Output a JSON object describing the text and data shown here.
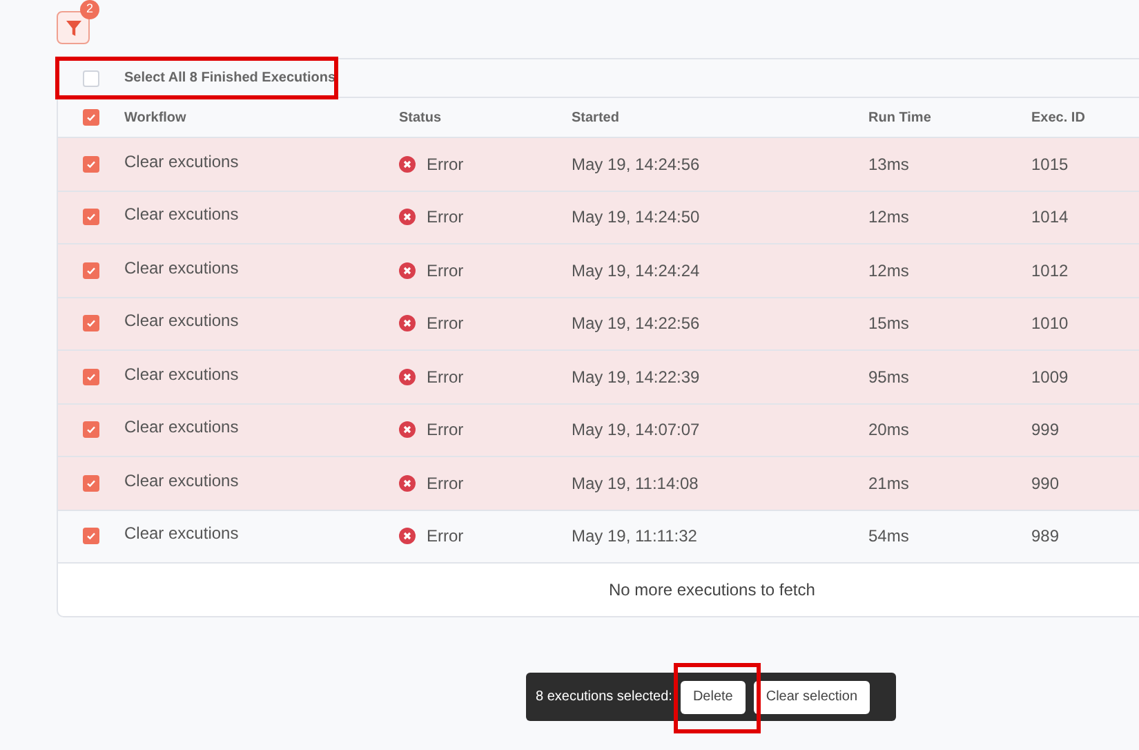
{
  "filter": {
    "badge": "2"
  },
  "select_all": {
    "label": "Select All 8 Finished Executions",
    "checked": false
  },
  "table": {
    "header_checked": true,
    "columns": [
      "Workflow",
      "Status",
      "Started",
      "Run Time",
      "Exec. ID"
    ],
    "rows": [
      {
        "workflow": "Clear excutions",
        "status": "Error",
        "started": "May 19, 14:24:56",
        "run_time": "13ms",
        "exec_id": "1015",
        "checked": true,
        "highlighted": true
      },
      {
        "workflow": "Clear excutions",
        "status": "Error",
        "started": "May 19, 14:24:50",
        "run_time": "12ms",
        "exec_id": "1014",
        "checked": true,
        "highlighted": true
      },
      {
        "workflow": "Clear excutions",
        "status": "Error",
        "started": "May 19, 14:24:24",
        "run_time": "12ms",
        "exec_id": "1012",
        "checked": true,
        "highlighted": true
      },
      {
        "workflow": "Clear excutions",
        "status": "Error",
        "started": "May 19, 14:22:56",
        "run_time": "15ms",
        "exec_id": "1010",
        "checked": true,
        "highlighted": true
      },
      {
        "workflow": "Clear excutions",
        "status": "Error",
        "started": "May 19, 14:22:39",
        "run_time": "95ms",
        "exec_id": "1009",
        "checked": true,
        "highlighted": true
      },
      {
        "workflow": "Clear excutions",
        "status": "Error",
        "started": "May 19, 14:07:07",
        "run_time": "20ms",
        "exec_id": "999",
        "checked": true,
        "highlighted": true
      },
      {
        "workflow": "Clear excutions",
        "status": "Error",
        "started": "May 19, 11:14:08",
        "run_time": "21ms",
        "exec_id": "990",
        "checked": true,
        "highlighted": true
      },
      {
        "workflow": "Clear excutions",
        "status": "Error",
        "started": "May 19, 11:11:32",
        "run_time": "54ms",
        "exec_id": "989",
        "checked": true,
        "highlighted": false
      }
    ],
    "footer": "No more executions to fetch"
  },
  "selection_bar": {
    "count_text": "8 executions selected:",
    "buttons": [
      "Delete",
      "Clear selection"
    ]
  }
}
